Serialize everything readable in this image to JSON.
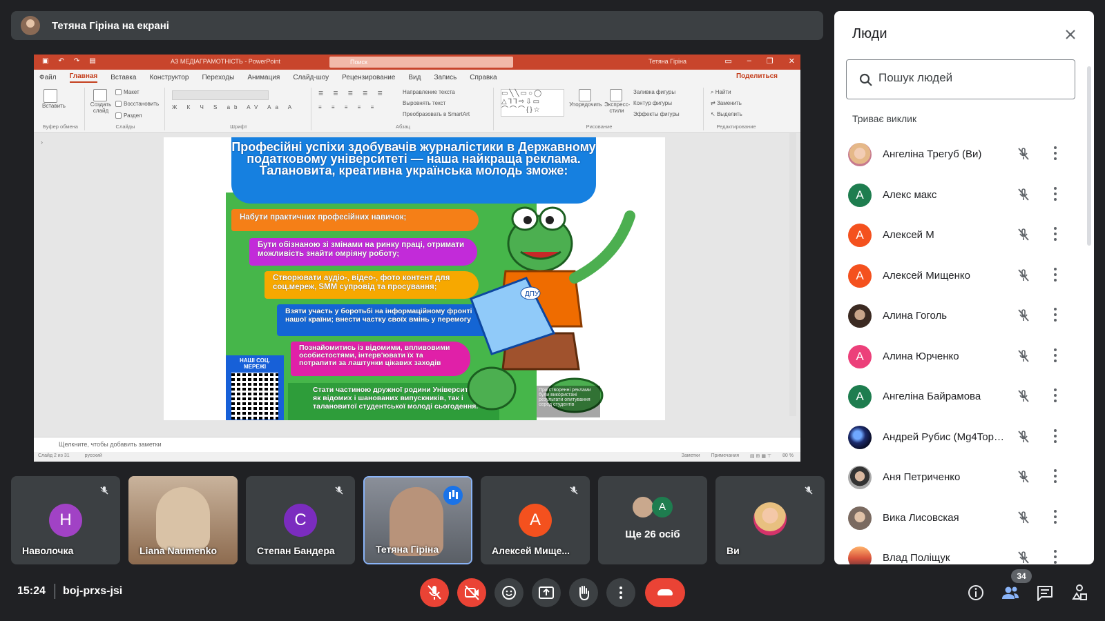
{
  "screen_share": {
    "banner_text": "Тетяна Гіріна на екрані"
  },
  "ppt": {
    "doc_title": "АЗ МЕДІАГРАМОТНІСТЬ - PowerPoint",
    "search_placeholder": "Поиск",
    "user": "Тетяна Гіріна",
    "tabs": [
      "Файл",
      "Главная",
      "Вставка",
      "Конструктор",
      "Переходы",
      "Анимация",
      "Слайд-шоу",
      "Рецензирование",
      "Вид",
      "Запись",
      "Справка"
    ],
    "active_tab": "Главная",
    "share": "Поделиться",
    "ribbon": {
      "paste": "Вставить",
      "clipboard": "Буфер обмена",
      "new_slide": "Создать слайд",
      "layout": "Макет",
      "reset": "Восстановить",
      "section": "Раздел",
      "slides": "Слайды",
      "font": "Шрифт",
      "text_dir": "Направление текста",
      "align_text": "Выровнять текст",
      "smartart": "Преобразовать в SmartArt",
      "paragraph": "Абзац",
      "arrange": "Упорядочить",
      "quick_styles": "Экспресс-стили",
      "shape_fill": "Заливка фигуры",
      "shape_outline": "Контур фигуры",
      "shape_effects": "Эффекты фигуры",
      "drawing": "Рисование",
      "find": "Найти",
      "replace": "Заменить",
      "select": "Выделить",
      "editing": "Редактирование"
    },
    "notes_placeholder": "Щелкните, чтобы добавить заметки",
    "status": {
      "slide": "Слайд 2 из 31",
      "lang": "русский",
      "notes": "Заметки",
      "comments": "Примечания",
      "zoom": "80 %"
    },
    "slide": {
      "heading": "Професійні успіхи здобувачів журналістики в Державному податковому університеті — наша найкраща реклама. Талановита, креативна українська молодь зможе:",
      "items": [
        "Набути практичних професійних навичок;",
        "Бути обізнаною зі змінами на ринку праці, отримати можливість знайти омріяну роботу;",
        "Створювати аудіо-, відео-, фото контент для соц.мереж, SMM супровід та просування;",
        "Взяти участь у боротьбі на інформаційному фронті нашої країни; внести частку своїх вмінь у перемогу",
        "Познайомитись із відомими, впливовими особистостями, інтерв'ювати їх та потрапити за лаштунки цікавих заходів",
        "Стати частиною дружної родини Університету, як відомих і шанованих випускників, так і талановитої студентської молоді сьогодення."
      ],
      "qr_label": "НАШІ СОЦ. МЕРЕЖІ",
      "laptop_label": "ДПУ",
      "caption": "При створенні реклами були використані результати опитування серед студентів"
    }
  },
  "tiles": [
    {
      "name": "Наволочка",
      "initial": "Н",
      "color": "#a142c5"
    },
    {
      "name": "Liana Naumenko"
    },
    {
      "name": "Степан Бандера",
      "initial": "С",
      "color": "#7b2cbf"
    },
    {
      "name": "Тетяна Гіріна"
    },
    {
      "name": "Алексей Мище...",
      "initial": "А",
      "color": "#f4511e"
    },
    {
      "name": "Ще 26 осіб",
      "initial": "А"
    },
    {
      "name": "Ви"
    }
  ],
  "bottom": {
    "time": "15:24",
    "meeting_code": "boj-prxs-jsi",
    "participants_count": "34"
  },
  "people": {
    "title": "Люди",
    "search_placeholder": "Пошук людей",
    "section": "Триває виклик",
    "list": [
      {
        "name": "Ангеліна Трегуб (Ви)",
        "photo": true
      },
      {
        "name": "Алекс макс",
        "initial": "А",
        "color": "#1e7d4f"
      },
      {
        "name": "Алексей М",
        "initial": "А",
        "color": "#f4511e"
      },
      {
        "name": "Алексей Мищенко",
        "initial": "А",
        "color": "#f4511e"
      },
      {
        "name": "Алина Гоголь",
        "photo": true
      },
      {
        "name": "Алина Юрченко",
        "initial": "А",
        "color": "#ec407a"
      },
      {
        "name": "Ангеліна Байрамова",
        "initial": "А",
        "color": "#1e7d4f"
      },
      {
        "name": "Андрей Рубис (Mg4Top4...",
        "photo": true
      },
      {
        "name": "Аня Петриченко",
        "photo": true
      },
      {
        "name": "Вика Лисовская",
        "photo": true
      },
      {
        "name": "Влад Поліщук",
        "photo": true
      }
    ]
  }
}
